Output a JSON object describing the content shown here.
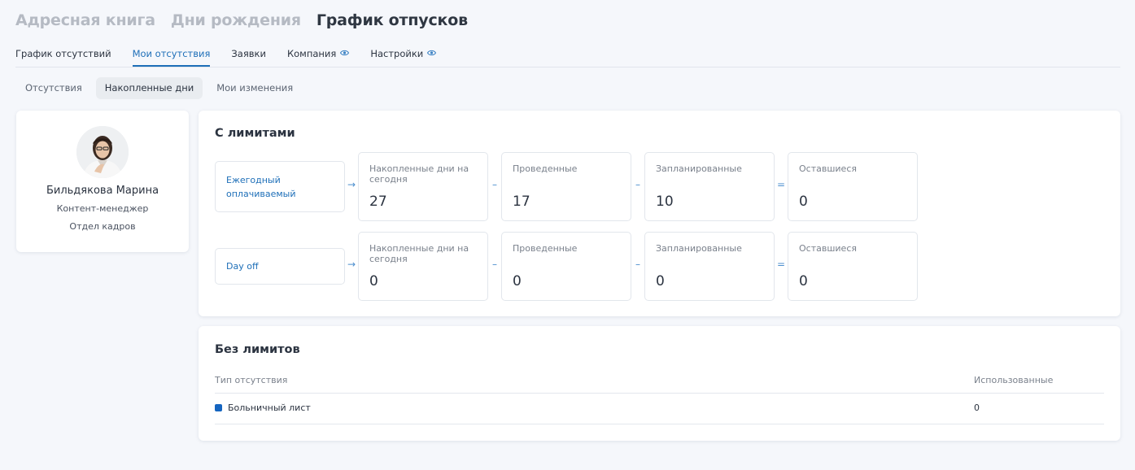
{
  "top_tabs": [
    "Адресная книга",
    "Дни рождения",
    "График отпусков"
  ],
  "nav": [
    {
      "label": "График отсутствий"
    },
    {
      "label": "Мои отсутствия"
    },
    {
      "label": "Заявки"
    },
    {
      "label": "Компания"
    },
    {
      "label": "Настройки"
    }
  ],
  "subtabs": [
    "Отсутствия",
    "Накопленные дни",
    "Мои изменения"
  ],
  "profile": {
    "name": "Бильдякова Марина",
    "role": "Контент-менеджер",
    "department": "Отдел кадров"
  },
  "limits": {
    "title": "С лимитами",
    "rows": [
      {
        "type": "Ежегодный оплачиваемый",
        "accrued_label": "Накопленные дни на сегодня",
        "accrued": "27",
        "spent_label": "Проведенные",
        "spent": "17",
        "planned_label": "Запланированные",
        "planned": "10",
        "remaining_label": "Оставшиеся",
        "remaining": "0"
      },
      {
        "type": "Day off",
        "accrued_label": "Накопленные дни на сегодня",
        "accrued": "0",
        "spent_label": "Проведенные",
        "spent": "0",
        "planned_label": "Запланированные",
        "planned": "0",
        "remaining_label": "Оставшиеся",
        "remaining": "0"
      }
    ],
    "ops": {
      "arrow": "→",
      "minus": "–",
      "equals": "="
    }
  },
  "nolimits": {
    "title": "Без лимитов",
    "col_type": "Тип отсутствия",
    "col_used": "Использованные",
    "rows": [
      {
        "type": "Больничный лист",
        "used": "0",
        "color": "#1565c0"
      }
    ]
  },
  "colors": {
    "accent": "#1e6fb8",
    "background": "#f5f7fb"
  },
  "icons": {
    "eye": "eye-icon"
  }
}
